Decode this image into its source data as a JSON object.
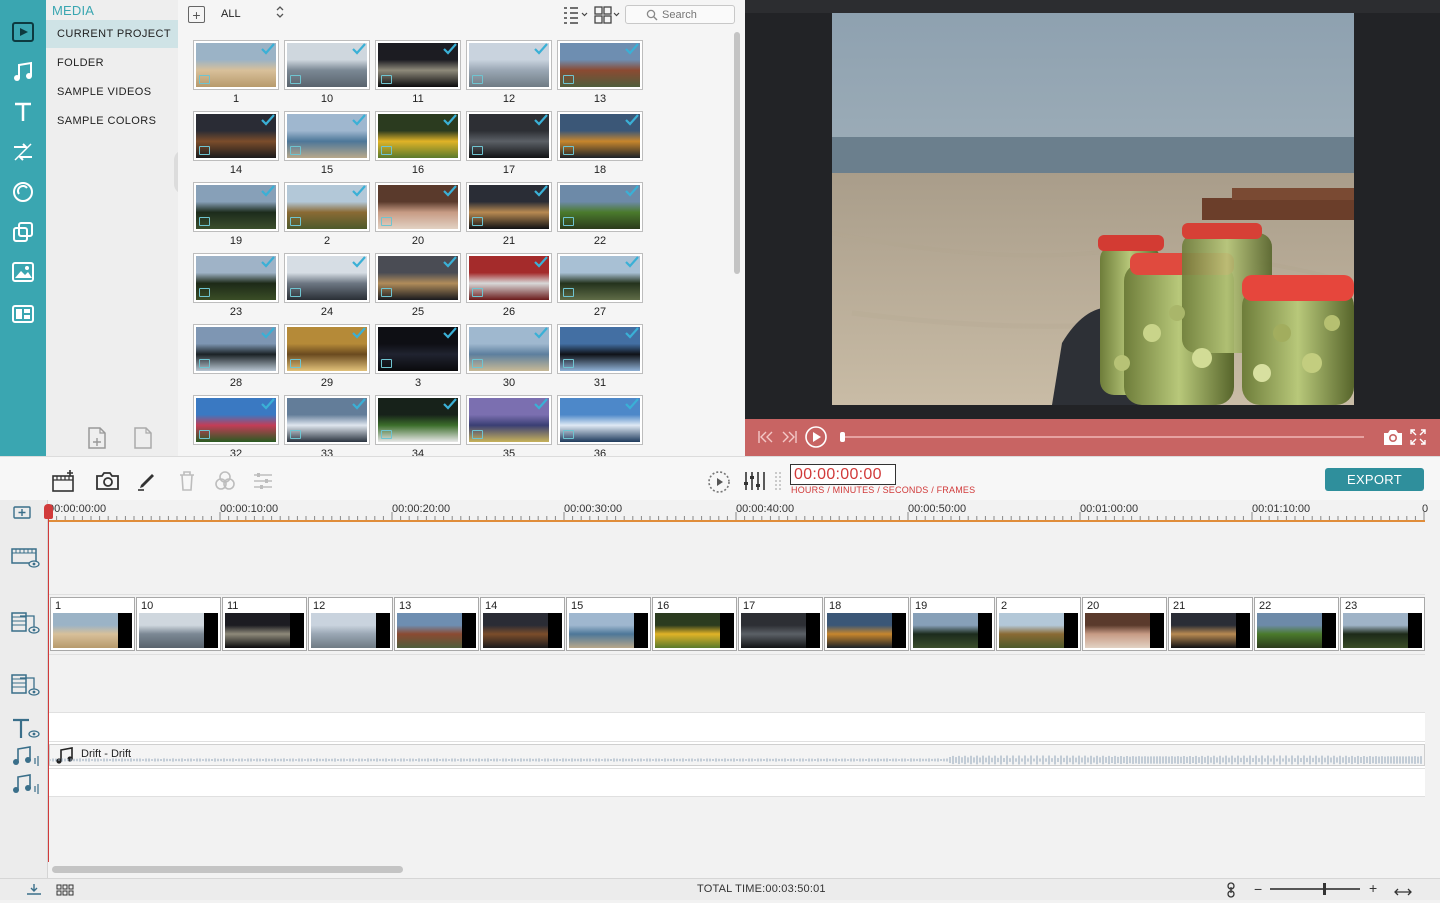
{
  "sidebar": {
    "title": "MEDIA",
    "items": [
      {
        "label": "CURRENT PROJECT",
        "active": true
      },
      {
        "label": "FOLDER",
        "active": false
      },
      {
        "label": "SAMPLE VIDEOS",
        "active": false
      },
      {
        "label": "SAMPLE COLORS",
        "active": false
      }
    ]
  },
  "rail": {
    "icons": [
      "media-icon",
      "music-icon",
      "text-icon",
      "transition-icon",
      "filter-icon",
      "overlay-icon",
      "element-icon",
      "split-screen-icon"
    ]
  },
  "browser": {
    "filter_value": "ALL",
    "search_placeholder": "Search",
    "thumbnails": [
      {
        "label": "1",
        "palette": [
          "#9bb3c6",
          "#d8c09a",
          "#b79a6c"
        ]
      },
      {
        "label": "10",
        "palette": [
          "#cfd7de",
          "#7b8894",
          "#59636d"
        ]
      },
      {
        "label": "11",
        "palette": [
          "#1c1c22",
          "#8e8a7a",
          "#0b0b0d"
        ]
      },
      {
        "label": "12",
        "palette": [
          "#c9d3de",
          "#9aa7b4",
          "#6f7b84"
        ]
      },
      {
        "label": "13",
        "palette": [
          "#6e8eb1",
          "#8b4a32",
          "#4f5e3c"
        ]
      },
      {
        "label": "14",
        "palette": [
          "#2a2c35",
          "#7b4d2b",
          "#1b1a1c"
        ]
      },
      {
        "label": "15",
        "palette": [
          "#9fb7cf",
          "#4d7799",
          "#b8a88b"
        ]
      },
      {
        "label": "16",
        "palette": [
          "#2b3b1f",
          "#e0b327",
          "#5a7a2c"
        ]
      },
      {
        "label": "17",
        "palette": [
          "#2d2f34",
          "#5b6066",
          "#121315"
        ]
      },
      {
        "label": "18",
        "palette": [
          "#3b5777",
          "#c7862d",
          "#1c2229"
        ]
      },
      {
        "label": "19",
        "palette": [
          "#87a0b8",
          "#1c2b1c",
          "#3b4e2c"
        ]
      },
      {
        "label": "2",
        "palette": [
          "#b3c8d8",
          "#8a6a34",
          "#4d5a2c"
        ]
      },
      {
        "label": "20",
        "palette": [
          "#5a3a2c",
          "#c79b84",
          "#e2d2c4"
        ]
      },
      {
        "label": "21",
        "palette": [
          "#2a2d36",
          "#b88a52",
          "#101114"
        ]
      },
      {
        "label": "22",
        "palette": [
          "#6d8aa8",
          "#4a7a2c",
          "#2c3b1c"
        ]
      },
      {
        "label": "23",
        "palette": [
          "#9fb3c7",
          "#1d2a18",
          "#3a4d26"
        ]
      },
      {
        "label": "24",
        "palette": [
          "#d6dde4",
          "#6d7783",
          "#2a2f36"
        ]
      },
      {
        "label": "25",
        "palette": [
          "#4a4c54",
          "#b08c5a",
          "#1a1a1e"
        ]
      },
      {
        "label": "26",
        "palette": [
          "#a42b2b",
          "#d8d8d8",
          "#6b1b1b"
        ]
      },
      {
        "label": "27",
        "palette": [
          "#a8c0d4",
          "#24331d",
          "#5f6c47"
        ]
      },
      {
        "label": "28",
        "palette": [
          "#7e96b3",
          "#1b2226",
          "#b8c5d1"
        ]
      },
      {
        "label": "29",
        "palette": [
          "#b58a38",
          "#6a4a1f",
          "#e2c27a"
        ]
      },
      {
        "label": "3",
        "palette": [
          "#0e0f14",
          "#202330",
          "#0a0a0c"
        ]
      },
      {
        "label": "30",
        "palette": [
          "#9fb8cf",
          "#5d7f9e",
          "#c7b996"
        ]
      },
      {
        "label": "31",
        "palette": [
          "#436fa3",
          "#0f1218",
          "#8fb1d6"
        ]
      },
      {
        "label": "32",
        "palette": [
          "#3a79c2",
          "#c33d57",
          "#2a5b21"
        ]
      },
      {
        "label": "33",
        "palette": [
          "#637d99",
          "#dfe6ee",
          "#2b3440"
        ]
      },
      {
        "label": "34",
        "palette": [
          "#17221a",
          "#3c6e2b",
          "#e8e8e8"
        ]
      },
      {
        "label": "35",
        "palette": [
          "#7b6fb0",
          "#3a3f74",
          "#c7b25a"
        ]
      },
      {
        "label": "36",
        "palette": [
          "#4d88c9",
          "#dfe9f4",
          "#1e3a5c"
        ]
      }
    ]
  },
  "preview": {
    "scene": "beach-with-jars"
  },
  "toolbar": {
    "timecode": "00:00:00:00",
    "timecode_label": "HOURS / MINUTES / SECONDS / FRAMES",
    "export_label": "EXPORT"
  },
  "timeline": {
    "ruler_labels": [
      "00:00:00:00",
      "00:00:10:00",
      "00:00:20:00",
      "00:00:30:00",
      "00:00:40:00",
      "00:00:50:00",
      "00:01:00:00",
      "00:01:10:00",
      "0"
    ],
    "clips": [
      {
        "label": "1",
        "palette": [
          "#9bb3c6",
          "#d8c09a",
          "#b79a6c"
        ]
      },
      {
        "label": "10",
        "palette": [
          "#cfd7de",
          "#7b8894",
          "#59636d"
        ]
      },
      {
        "label": "11",
        "palette": [
          "#1c1c22",
          "#8e8a7a",
          "#0b0b0d"
        ]
      },
      {
        "label": "12",
        "palette": [
          "#c9d3de",
          "#9aa7b4",
          "#6f7b84"
        ]
      },
      {
        "label": "13",
        "palette": [
          "#6e8eb1",
          "#8b4a32",
          "#4f5e3c"
        ]
      },
      {
        "label": "14",
        "palette": [
          "#2a2c35",
          "#7b4d2b",
          "#1b1a1c"
        ]
      },
      {
        "label": "15",
        "palette": [
          "#9fb7cf",
          "#4d7799",
          "#b8a88b"
        ]
      },
      {
        "label": "16",
        "palette": [
          "#2b3b1f",
          "#e0b327",
          "#5a7a2c"
        ]
      },
      {
        "label": "17",
        "palette": [
          "#2d2f34",
          "#5b6066",
          "#121315"
        ]
      },
      {
        "label": "18",
        "palette": [
          "#3b5777",
          "#c7862d",
          "#1c2229"
        ]
      },
      {
        "label": "19",
        "palette": [
          "#87a0b8",
          "#1c2b1c",
          "#3b4e2c"
        ]
      },
      {
        "label": "2",
        "palette": [
          "#b3c8d8",
          "#8a6a34",
          "#4d5a2c"
        ]
      },
      {
        "label": "20",
        "palette": [
          "#5a3a2c",
          "#c79b84",
          "#e2d2c4"
        ]
      },
      {
        "label": "21",
        "palette": [
          "#2a2d36",
          "#b88a52",
          "#101114"
        ]
      },
      {
        "label": "22",
        "palette": [
          "#6d8aa8",
          "#4a7a2c",
          "#2c3b1c"
        ]
      },
      {
        "label": "23",
        "palette": [
          "#9fb3c7",
          "#1d2a18",
          "#3a4d26"
        ]
      }
    ],
    "audio_clip_name": "Drift - Drift"
  },
  "status": {
    "total_time": "TOTAL TIME:00:03:50:01",
    "zoom_level": 0.6
  },
  "colors": {
    "accent": "#3aa6b1",
    "player_bar": "#c86463",
    "playhead": "#d13a3a",
    "export": "#2f8f9c"
  }
}
